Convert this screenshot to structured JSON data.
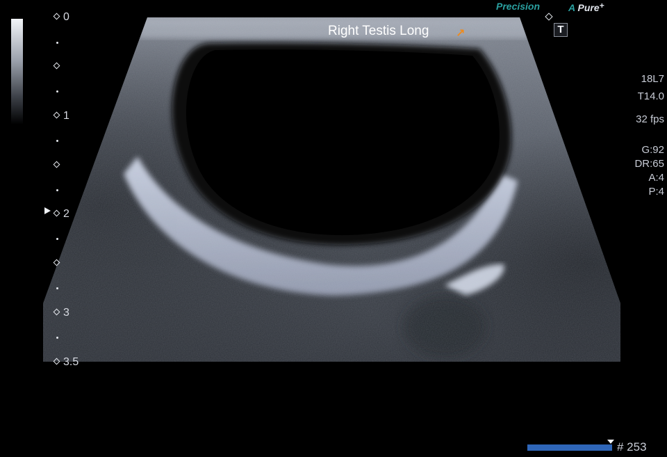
{
  "brand": {
    "precision": "Precision",
    "apure_a": "A",
    "apure_pure": "Pure",
    "apure_plus": "+"
  },
  "annotation": {
    "label": "Right Testis Long"
  },
  "t_button": {
    "label": "T"
  },
  "depth_scale": {
    "unit": "cm",
    "ticks": [
      "0",
      "1",
      "2",
      "3",
      "3.5"
    ]
  },
  "info_panel": {
    "transducer": "18L7",
    "thermal_index": "T14.0",
    "frame_rate": "32 fps",
    "gain": "G:92",
    "dynamic_range": "DR:65",
    "a_value": "A:4",
    "p_value": "P:4"
  },
  "cine": {
    "frame_label": "# 253"
  },
  "colors": {
    "background": "#000000",
    "accent_teal": "#2aa0a0",
    "cursor_orange": "#f08a1a",
    "cine_blue": "#2f66b8"
  }
}
